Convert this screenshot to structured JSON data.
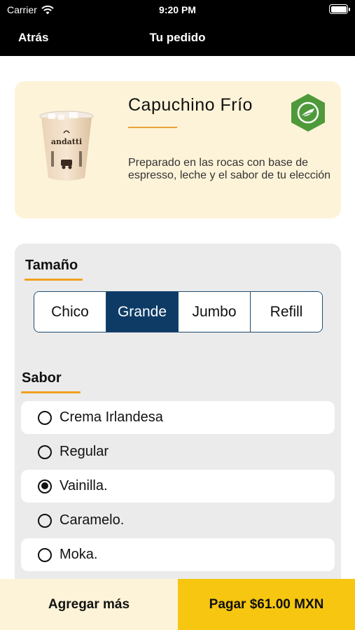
{
  "status_bar": {
    "carrier": "Carrier",
    "time": "9:20 PM"
  },
  "nav": {
    "back_label": "Atrás",
    "title": "Tu pedido"
  },
  "product": {
    "name": "Capuchino Frío",
    "description": "Preparado en las rocas con base de espresso, leche y el sabor de tu elección",
    "cup_brand": "andatti",
    "badge_icon": "leaf-badge-icon"
  },
  "size": {
    "title": "Tamaño",
    "options": [
      "Chico",
      "Grande",
      "Jumbo",
      "Refill"
    ],
    "selected": "Grande"
  },
  "flavor": {
    "title": "Sabor",
    "options": [
      "Crema Irlandesa",
      "Regular",
      "Vainilla.",
      "Caramelo.",
      "Moka."
    ],
    "selected": "Vainilla."
  },
  "actions": {
    "add_more": "Agregar más",
    "pay": "Pagar $61.00 MXN"
  },
  "colors": {
    "accent": "#f0a11c",
    "selected_size": "#0d3b66",
    "pay_button": "#f6c611",
    "card_bg": "#fdf3d8",
    "badge_green": "#4e9a3b"
  }
}
